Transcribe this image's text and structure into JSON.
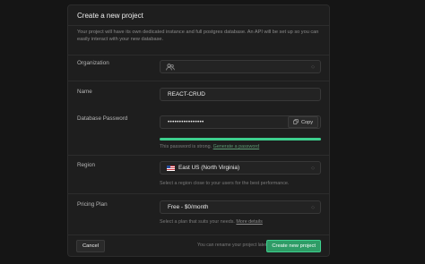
{
  "dialog": {
    "title": "Create a new project",
    "intro": "Your project will have its own dedicated instance and full postgres database. An API will be set up so you can easily interact with your new database."
  },
  "organization": {
    "label": "Organization",
    "value": "",
    "icon": "users-icon"
  },
  "name": {
    "label": "Name",
    "value": "REACT-CRUD"
  },
  "password": {
    "label": "Database Password",
    "value": "••••••••••••••••",
    "copy_label": "Copy",
    "strength_text": "This password is strong.",
    "generate_link": "Generate a password",
    "strength_color": "#3ecf8e",
    "strength": 1
  },
  "region": {
    "label": "Region",
    "value": "East US (North Virginia)",
    "help": "Select a region close to your users for the best performance."
  },
  "pricing": {
    "label": "Pricing Plan",
    "value": "Free - $0/month",
    "help": "Select a plan that suits your needs.",
    "details_link": "More details"
  },
  "footer": {
    "cancel_label": "Cancel",
    "note": "You can rename your project later",
    "create_label": "Create new project"
  },
  "colors": {
    "accent": "#3ecf8e",
    "panel": "#1e1e1e",
    "background": "#151515"
  }
}
